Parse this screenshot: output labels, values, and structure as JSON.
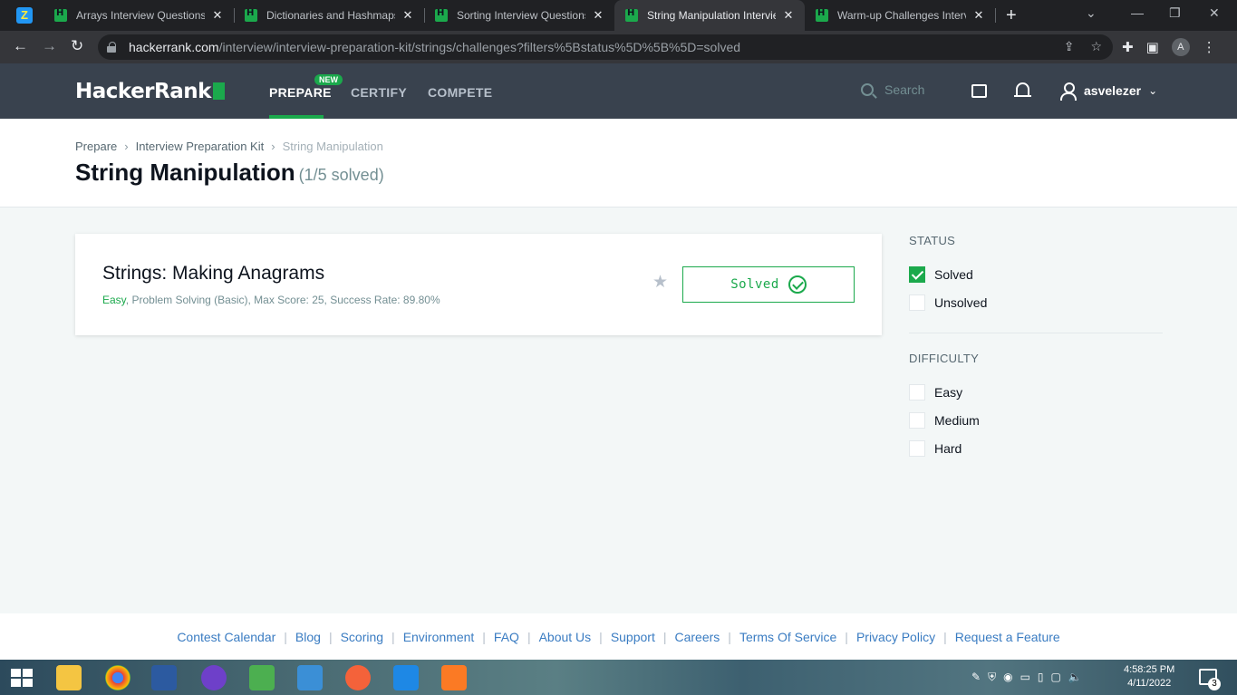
{
  "browser": {
    "tabs": [
      {
        "title": "Arrays Interview Questions | ",
        "active": false
      },
      {
        "title": "Dictionaries and Hashmaps",
        "active": false
      },
      {
        "title": "Sorting Interview Questions",
        "active": false
      },
      {
        "title": "String Manipulation Intervie",
        "active": true
      },
      {
        "title": "Warm-up Challenges Interv",
        "active": false
      }
    ],
    "url_host": "hackerrank.com",
    "url_path": "/interview/interview-preparation-kit/strings/challenges?filters%5Bstatus%5D%5B%5D=solved",
    "profile_initial": "A"
  },
  "nav": {
    "logo": "HackerRank",
    "links": [
      {
        "label": "PREPARE",
        "active": true
      },
      {
        "label": "CERTIFY",
        "active": false
      },
      {
        "label": "COMPETE",
        "active": false
      }
    ],
    "new_badge": "NEW",
    "search_placeholder": "Search",
    "username": "asvelezer"
  },
  "header": {
    "breadcrumb": [
      "Prepare",
      "Interview Preparation Kit",
      "String Manipulation"
    ],
    "title": "String Manipulation",
    "subtitle": "(1/5 solved)"
  },
  "challenge": {
    "title": "Strings: Making Anagrams",
    "difficulty": "Easy",
    "meta": ", Problem Solving (Basic), Max Score: 25, Success Rate: 89.80%",
    "status_label": "Solved"
  },
  "filters": {
    "status": {
      "heading": "STATUS",
      "options": [
        {
          "label": "Solved",
          "checked": true
        },
        {
          "label": "Unsolved",
          "checked": false
        }
      ]
    },
    "difficulty": {
      "heading": "DIFFICULTY",
      "options": [
        {
          "label": "Easy",
          "checked": false
        },
        {
          "label": "Medium",
          "checked": false
        },
        {
          "label": "Hard",
          "checked": false
        }
      ]
    }
  },
  "footer": {
    "links": [
      "Contest Calendar",
      "Blog",
      "Scoring",
      "Environment",
      "FAQ",
      "About Us",
      "Support",
      "Careers",
      "Terms Of Service",
      "Privacy Policy",
      "Request a Feature"
    ]
  },
  "taskbar": {
    "time": "4:58:25 PM",
    "date": "4/11/2022",
    "notification_count": "3"
  },
  "colors": {
    "brand_green": "#1ba94c",
    "nav_bg": "#39424e",
    "link_blue": "#3a7cc2"
  }
}
